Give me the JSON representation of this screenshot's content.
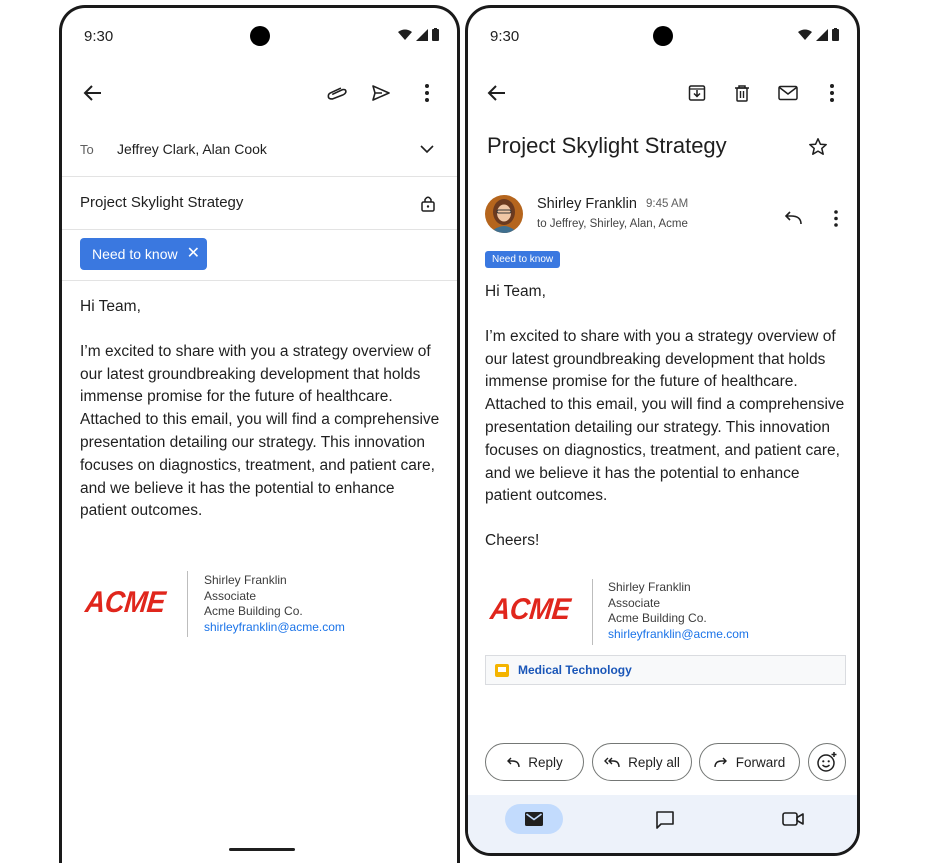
{
  "status": {
    "time": "9:30"
  },
  "compose": {
    "to_label": "To",
    "recipients": "Jeffrey Clark, Alan Cook",
    "subject": "Project Skylight Strategy",
    "label_chip": "Need to know",
    "label_chip_close": "✕",
    "greeting": "Hi Team,",
    "body": "I’m excited to share with you a strategy overview of our latest groundbreaking development that holds immense promise for the future of healthcare. Attached to this email, you will find a comprehensive presentation detailing our strategy. This innovation focuses on diagnostics, treatment, and patient care, and we believe it has the potential to enhance patient outcomes.",
    "signature": {
      "logo": "ACME",
      "name": "Shirley Franklin",
      "title": "Associate",
      "company": "Acme Building Co.",
      "email": "shirleyfranklin@acme.com"
    }
  },
  "read": {
    "subject": "Project Skylight Strategy",
    "sender": "Shirley Franklin",
    "time": "9:45 AM",
    "to_line": "to Jeffrey, Shirley, Alan, Acme",
    "label": "Need to know",
    "greeting": "Hi Team,",
    "body": "I’m excited to share with you a strategy overview of our latest groundbreaking development that holds immense promise for the future of healthcare. Attached to this email, you will find a comprehensive presentation detailing our strategy. This innovation focuses on diagnostics, treatment, and patient care, and we believe it has the potential to enhance patient outcomes.",
    "closing": "Cheers!",
    "signature": {
      "logo": "ACME",
      "name": "Shirley Franklin",
      "title": "Associate",
      "company": "Acme Building Co.",
      "email": "shirleyfranklin@acme.com"
    },
    "attachment": "Medical Technology",
    "actions": {
      "reply": "Reply",
      "reply_all": "Reply all",
      "forward": "Forward"
    }
  },
  "colors": {
    "accent": "#3a78e0",
    "link": "#1a73e8",
    "acme_red": "#e0261c",
    "nav_bg": "#edf2fa",
    "nav_active": "#c2dbfd"
  }
}
